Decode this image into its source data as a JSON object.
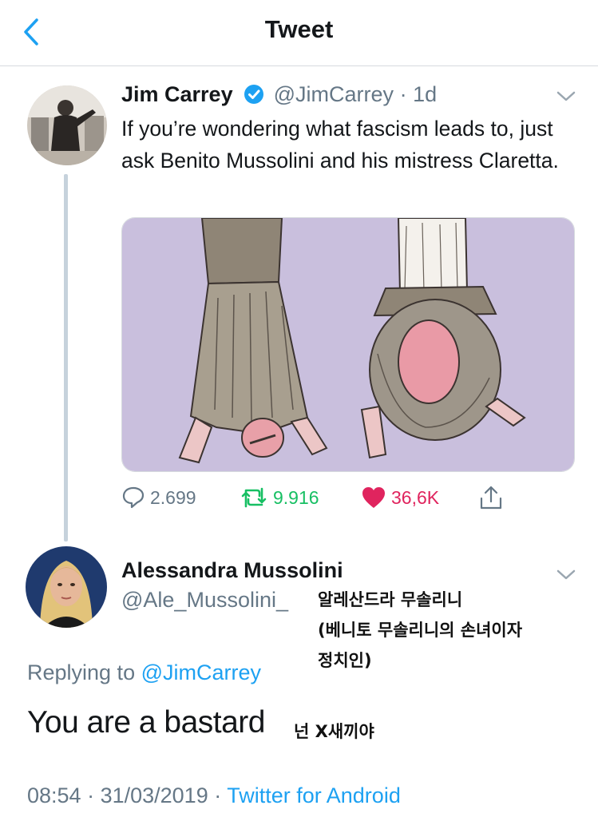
{
  "header": {
    "title": "Tweet",
    "back_icon": "chevron-left-icon"
  },
  "tweet": {
    "author_name": "Jim Carrey",
    "handle": "@JimCarrey",
    "separator": "·",
    "age": "1d",
    "text": "If you’re wondering what fascism leads to, just ask Benito Mussolini and his mistress Claretta.",
    "stats": {
      "replies": "2.699",
      "retweets": "9.916",
      "likes": "36,6K"
    },
    "colors": {
      "retweet": "#17bf63",
      "like": "#e0245e",
      "link": "#1da1f2",
      "media_bg": "#c9bfdd"
    }
  },
  "reply": {
    "author_name": "Alessandra Mussolini",
    "handle": "@Ale_Mussolini_",
    "replying_prefix": "Replying to",
    "replying_to": "@JimCarrey",
    "text": "You are a bastard",
    "time": "08:54",
    "date": "31/03/2019",
    "sep1": " · ",
    "sep2": " · ",
    "source": "Twitter for Android"
  },
  "annotations": {
    "line1": "알레산드라 무솔리니",
    "line2": "(베니토 무솔리니의 손녀이자",
    "line3": "정치인)",
    "line4": "넌 X새끼야"
  }
}
